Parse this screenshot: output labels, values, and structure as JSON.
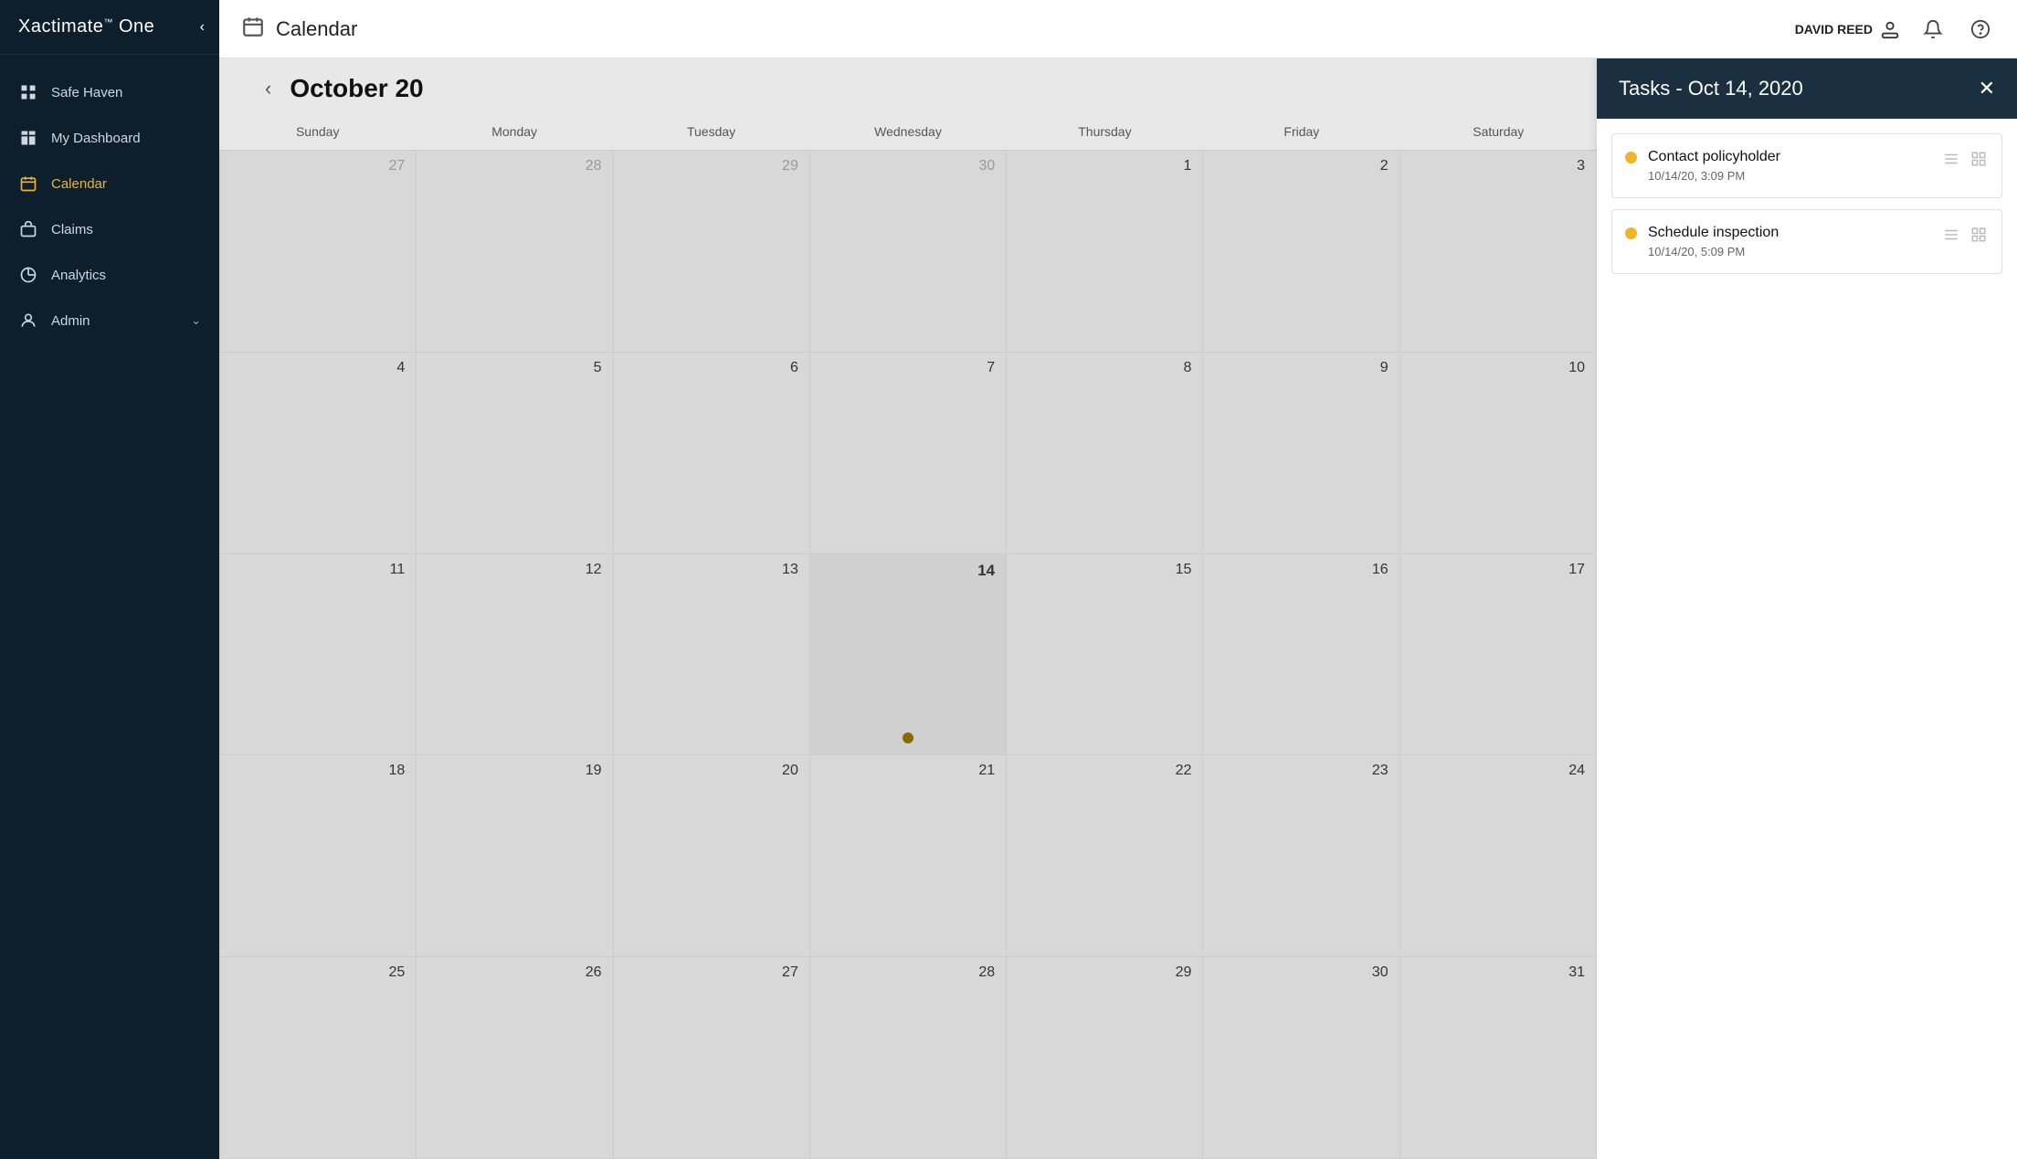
{
  "app": {
    "title": "Xactimate",
    "title_super": "™",
    "title_suffix": " One"
  },
  "sidebar": {
    "collapse_icon": "‹",
    "items": [
      {
        "id": "safe-haven",
        "label": "Safe Haven",
        "icon": "building"
      },
      {
        "id": "my-dashboard",
        "label": "My Dashboard",
        "icon": "dashboard"
      },
      {
        "id": "calendar",
        "label": "Calendar",
        "icon": "calendar",
        "active": true
      },
      {
        "id": "claims",
        "label": "Claims",
        "icon": "briefcase"
      },
      {
        "id": "analytics",
        "label": "Analytics",
        "icon": "analytics"
      },
      {
        "id": "admin",
        "label": "Admin",
        "icon": "admin",
        "has_chevron": true
      }
    ]
  },
  "header": {
    "title": "Calendar",
    "user_name": "DAVID REED",
    "bell_label": "Notifications",
    "help_label": "Help"
  },
  "calendar": {
    "nav_prev": "‹",
    "month_title": "October 20",
    "weekdays": [
      "Sunday",
      "Monday",
      "Tuesday",
      "Wednesday",
      "Thursday",
      "Friday",
      "Saturday"
    ],
    "weeks": [
      [
        {
          "day": "27",
          "other": true
        },
        {
          "day": "28",
          "other": true
        },
        {
          "day": "29",
          "other": true
        },
        {
          "day": "30",
          "other": true
        },
        {
          "day": "1",
          "other": false
        },
        {
          "day": "2",
          "other": false
        },
        {
          "day": "3",
          "other": false
        }
      ],
      [
        {
          "day": "4",
          "other": false
        },
        {
          "day": "5",
          "other": false
        },
        {
          "day": "6",
          "other": false
        },
        {
          "day": "7",
          "other": false
        },
        {
          "day": "8",
          "other": false
        },
        {
          "day": "9",
          "other": false
        },
        {
          "day": "10",
          "other": false
        }
      ],
      [
        {
          "day": "11",
          "other": false
        },
        {
          "day": "12",
          "other": false
        },
        {
          "day": "13",
          "other": false
        },
        {
          "day": "14",
          "other": false,
          "current": true,
          "bold": true,
          "has_dot": true
        },
        {
          "day": "15",
          "other": false
        },
        {
          "day": "16",
          "other": false
        },
        {
          "day": "17",
          "other": false
        }
      ],
      [
        {
          "day": "18",
          "other": false
        },
        {
          "day": "19",
          "other": false
        },
        {
          "day": "20",
          "other": false
        },
        {
          "day": "21",
          "other": false
        },
        {
          "day": "22",
          "other": false
        },
        {
          "day": "23",
          "other": false
        },
        {
          "day": "24",
          "other": false
        }
      ],
      [
        {
          "day": "25",
          "other": false
        },
        {
          "day": "26",
          "other": false
        },
        {
          "day": "27",
          "other": false
        },
        {
          "day": "28",
          "other": false
        },
        {
          "day": "29",
          "other": false
        },
        {
          "day": "30",
          "other": false
        },
        {
          "day": "31",
          "other": false
        }
      ]
    ]
  },
  "tasks_panel": {
    "title": "Tasks - Oct 14, 2020",
    "close_btn": "✕",
    "tasks": [
      {
        "name": "Contact policyholder",
        "time": "10/14/20, 3:09 PM"
      },
      {
        "name": "Schedule inspection",
        "time": "10/14/20, 5:09 PM"
      }
    ]
  }
}
